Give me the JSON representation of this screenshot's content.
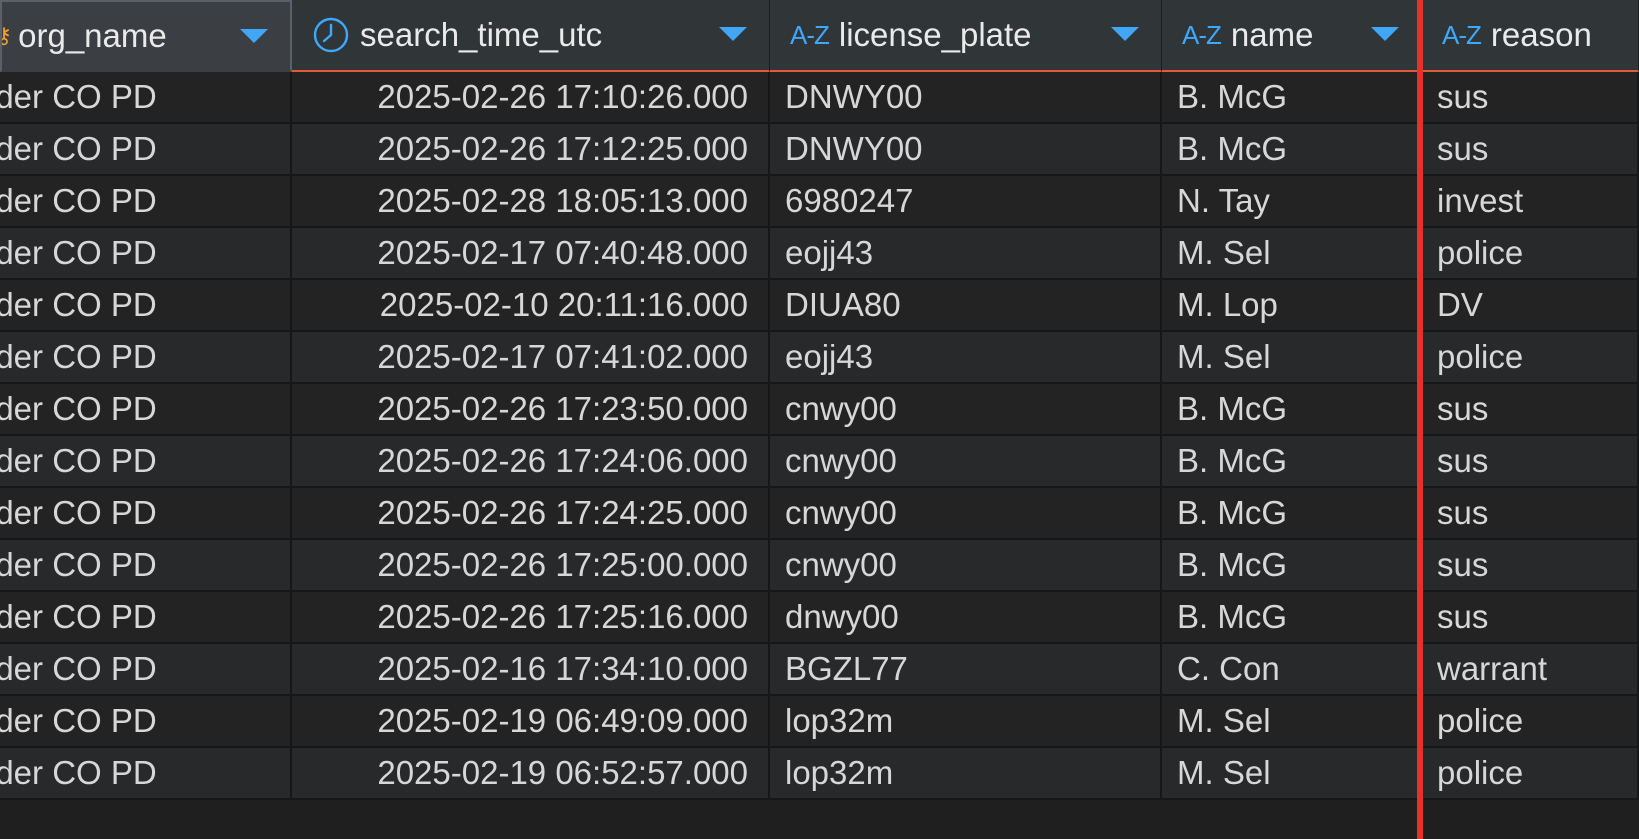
{
  "columns": [
    {
      "label": "org_name",
      "icon": "key-icon",
      "sort": "chevron-down-icon"
    },
    {
      "label": "search_time_utc",
      "icon": "clock-icon",
      "sort": "chevron-down-icon"
    },
    {
      "label": "license_plate",
      "icon": "az-text-icon",
      "icon_text": "A-Z",
      "sort": "chevron-down-icon"
    },
    {
      "label": "name",
      "icon": "az-text-icon",
      "icon_text": "A-Z",
      "sort": "chevron-down-icon"
    },
    {
      "label": "reason",
      "icon": "az-text-icon",
      "icon_text": "A-Z"
    }
  ],
  "rows": [
    {
      "org": "lder CO PD",
      "time": "2025-02-26 17:10:26.000",
      "plate": "DNWY00",
      "name": "B. McG",
      "reason": "sus"
    },
    {
      "org": "lder CO PD",
      "time": "2025-02-26 17:12:25.000",
      "plate": "DNWY00",
      "name": "B. McG",
      "reason": "sus"
    },
    {
      "org": "lder CO PD",
      "time": "2025-02-28 18:05:13.000",
      "plate": "6980247",
      "name": "N. Tay",
      "reason": "invest"
    },
    {
      "org": "lder CO PD",
      "time": "2025-02-17 07:40:48.000",
      "plate": "eojj43",
      "name": "M. Sel",
      "reason": "police"
    },
    {
      "org": "lder CO PD",
      "time": "2025-02-10 20:11:16.000",
      "plate": "DIUA80",
      "name": "M. Lop",
      "reason": "DV"
    },
    {
      "org": "lder CO PD",
      "time": "2025-02-17 07:41:02.000",
      "plate": "eojj43",
      "name": "M. Sel",
      "reason": "police"
    },
    {
      "org": "lder CO PD",
      "time": "2025-02-26 17:23:50.000",
      "plate": "cnwy00",
      "name": "B. McG",
      "reason": "sus"
    },
    {
      "org": "lder CO PD",
      "time": "2025-02-26 17:24:06.000",
      "plate": "cnwy00",
      "name": "B. McG",
      "reason": "sus"
    },
    {
      "org": "lder CO PD",
      "time": "2025-02-26 17:24:25.000",
      "plate": "cnwy00",
      "name": "B. McG",
      "reason": "sus"
    },
    {
      "org": "lder CO PD",
      "time": "2025-02-26 17:25:00.000",
      "plate": "cnwy00",
      "name": "B. McG",
      "reason": "sus"
    },
    {
      "org": "lder CO PD",
      "time": "2025-02-26 17:25:16.000",
      "plate": "dnwy00",
      "name": "B. McG",
      "reason": "sus"
    },
    {
      "org": "lder CO PD",
      "time": "2025-02-16 17:34:10.000",
      "plate": "BGZL77",
      "name": "C. Con",
      "reason": "warrant"
    },
    {
      "org": "lder CO PD",
      "time": "2025-02-19 06:49:09.000",
      "plate": "lop32m",
      "name": "M. Sel",
      "reason": "police"
    },
    {
      "org": "lder CO PD",
      "time": "2025-02-19 06:52:57.000",
      "plate": "lop32m",
      "name": "M. Sel",
      "reason": "police"
    }
  ],
  "colors": {
    "header_bg": "#303538",
    "row_even": "#232324",
    "row_odd": "#28292a",
    "header_underline": "#e15a3a",
    "type_icon": "#3ea8ff",
    "sort_arrow": "#41a6f5",
    "key_icon": "#f0a032",
    "red_marker": "#e5322b"
  }
}
